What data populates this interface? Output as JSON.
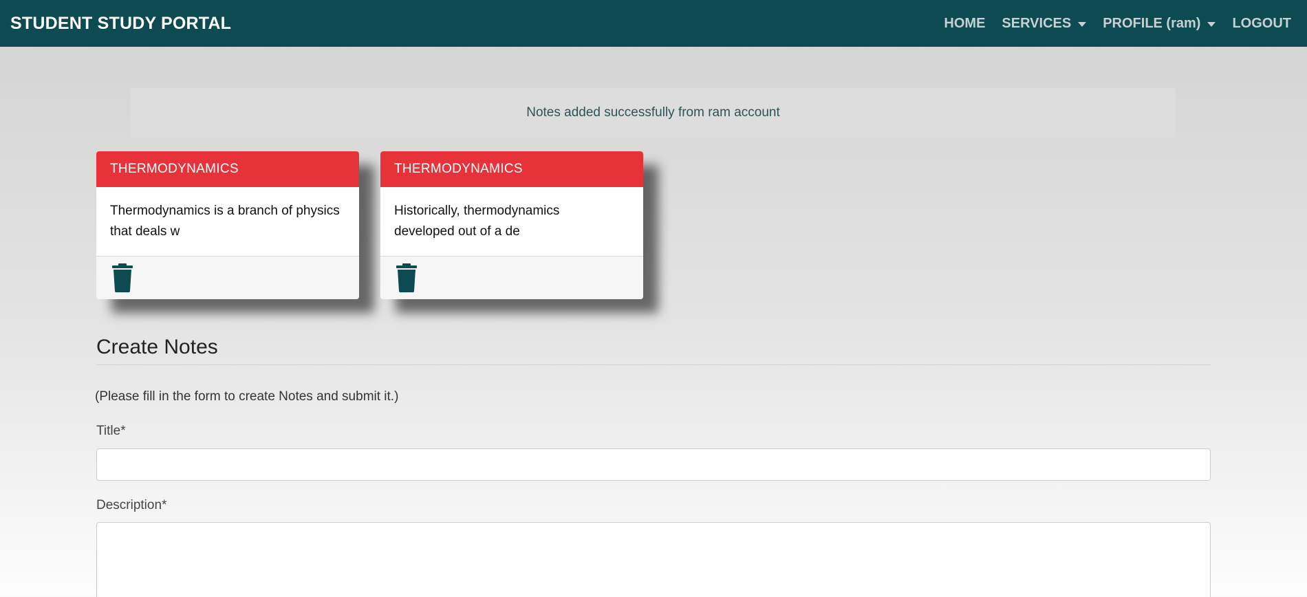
{
  "navbar": {
    "brand": "STUDENT STUDY PORTAL",
    "links": [
      {
        "label": "HOME",
        "dropdown": false
      },
      {
        "label": "SERVICES",
        "dropdown": true
      },
      {
        "label": "PROFILE (ram)",
        "dropdown": true
      },
      {
        "label": "LOGOUT",
        "dropdown": false
      }
    ],
    "background_color": "#0d4a52"
  },
  "alert": {
    "message": "Notes added successfully from ram account"
  },
  "notes": [
    {
      "title": "THERMODYNAMICS",
      "body_line1": "Thermodynamics is a branch of physics",
      "body_line2": "that deals w",
      "delete_icon": "trash-icon"
    },
    {
      "title": "THERMODYNAMICS",
      "body_line1": "Historically, thermodynamics",
      "body_line2": "developed out of a de",
      "delete_icon": "trash-icon"
    }
  ],
  "create_form": {
    "heading": "Create Notes",
    "instructions": "(Please fill in the form to create Notes and submit it.)",
    "title_label": "Title*",
    "title_value": "",
    "description_label": "Description*",
    "description_value": ""
  },
  "colors": {
    "card_header": "#e8323a",
    "accent": "#0d4a52"
  }
}
